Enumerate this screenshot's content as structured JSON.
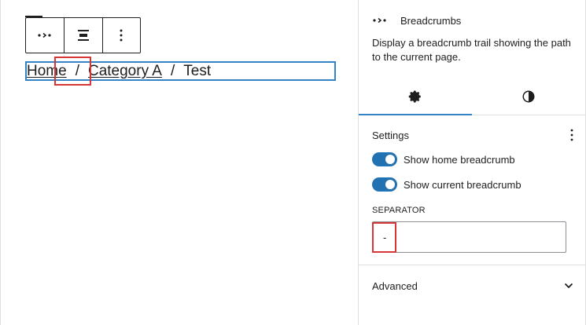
{
  "breadcrumbs": {
    "items": [
      "Home",
      "Category A"
    ],
    "separator": "/",
    "current": "Test"
  },
  "sidebar": {
    "block": {
      "icon": "breadcrumbs-icon",
      "title": "Breadcrumbs",
      "description": "Display a breadcrumb trail showing the path to the current page."
    },
    "tabs": [
      {
        "icon": "gear-icon",
        "active": true
      },
      {
        "icon": "contrast-icon",
        "active": false
      }
    ],
    "settings": {
      "title": "Settings",
      "toggles": [
        {
          "label": "Show home breadcrumb",
          "checked": true
        },
        {
          "label": "Show current breadcrumb",
          "checked": true
        }
      ],
      "separator_label": "SEPARATOR",
      "separator_value": "-"
    },
    "advanced": {
      "title": "Advanced"
    }
  },
  "colors": {
    "accent": "#3582c4",
    "toggle": "#2271b1",
    "highlight": "#d63638"
  }
}
